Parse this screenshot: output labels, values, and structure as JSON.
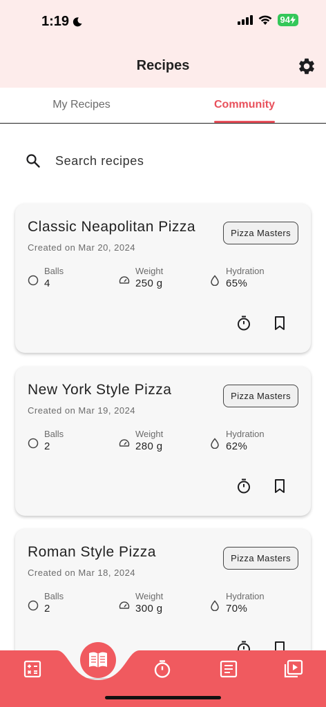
{
  "status_bar": {
    "time": "1:19",
    "battery": "94"
  },
  "header": {
    "title": "Recipes"
  },
  "tabs": [
    {
      "label": "My Recipes",
      "active": false
    },
    {
      "label": "Community",
      "active": true
    }
  ],
  "search": {
    "placeholder": "Search recipes"
  },
  "recipes": [
    {
      "title": "Classic Neapolitan Pizza",
      "date": "Created on Mar 20, 2024",
      "badge": "Pizza Masters",
      "balls_label": "Balls",
      "balls": "4",
      "weight_label": "Weight",
      "weight": "250 g",
      "hydration_label": "Hydration",
      "hydration": "65%"
    },
    {
      "title": "New York Style Pizza",
      "date": "Created on Mar 19, 2024",
      "badge": "Pizza Masters",
      "balls_label": "Balls",
      "balls": "2",
      "weight_label": "Weight",
      "weight": "280 g",
      "hydration_label": "Hydration",
      "hydration": "62%"
    },
    {
      "title": "Roman Style Pizza",
      "date": "Created on Mar 18, 2024",
      "badge": "Pizza Masters",
      "balls_label": "Balls",
      "balls": "2",
      "weight_label": "Weight",
      "weight": "300 g",
      "hydration_label": "Hydration",
      "hydration": "70%"
    }
  ],
  "colors": {
    "accent": "#e8505b",
    "header_bg": "#fdeceb",
    "nav_bg": "#f05a5f",
    "card_bg": "#f7f7f7"
  },
  "bottom_nav": {
    "items": [
      "calculator-icon",
      "recipe-book-icon",
      "timer-icon",
      "notes-icon",
      "video-library-icon"
    ],
    "active": "recipe-book-icon"
  }
}
